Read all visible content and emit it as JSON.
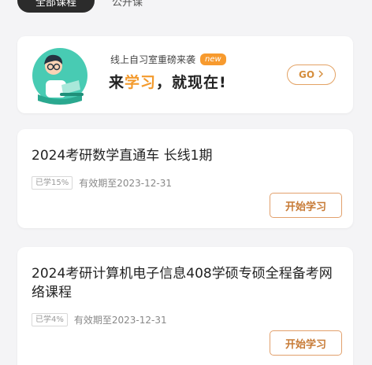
{
  "tabs": [
    {
      "label": "全部课程"
    },
    {
      "label": "公开课"
    }
  ],
  "promo": {
    "subtitle": "线上自习室重磅来袭",
    "badge": "new",
    "title_prefix": "来",
    "title_highlight": "学习",
    "title_suffix": "，就现在!",
    "go_label": "GO",
    "go_icon": "chevron-right",
    "accent_color": "#f39a2c",
    "avatar_icon": "student-studying-illustration"
  },
  "courses": [
    {
      "title": "2024考研数学直通车 长线1期",
      "progress": "已学15%",
      "validity": "有效期至2023-12-31",
      "action": "开始学习"
    },
    {
      "title": "2024考研计算机电子信息408学硕专硕全程备考网络课程",
      "progress": "已学4%",
      "validity": "有效期至2023-12-31",
      "action": "开始学习"
    }
  ]
}
